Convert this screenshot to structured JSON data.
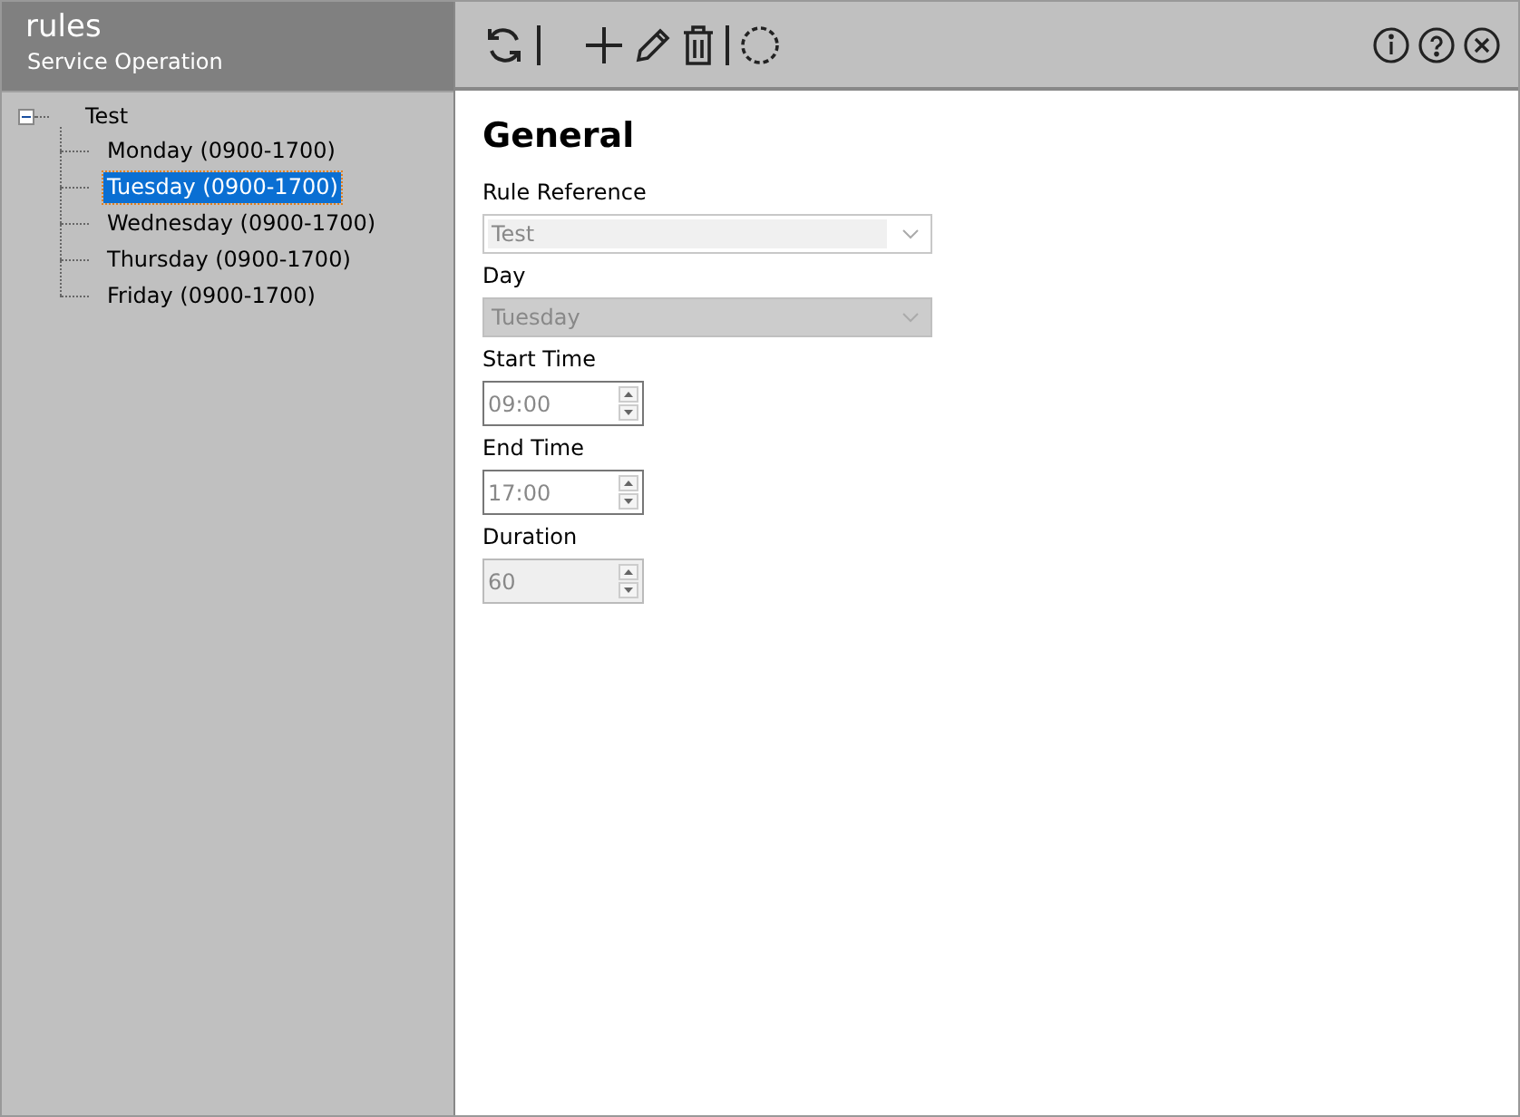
{
  "app": {
    "title": "rules",
    "subtitle": "Service Operation"
  },
  "tree": [
    {
      "label": "Test",
      "expanded": true,
      "children": [
        {
          "label": "Monday (0900-1700)",
          "selected": false
        },
        {
          "label": "Tuesday  (0900-1700)",
          "selected": true
        },
        {
          "label": "Wednesday (0900-1700)",
          "selected": false
        },
        {
          "label": "Thursday  (0900-1700)",
          "selected": false
        },
        {
          "label": "Friday  (0900-1700)",
          "selected": false
        }
      ]
    }
  ],
  "form": {
    "heading": "General",
    "fields": [
      {
        "kind": "dropdown",
        "label": "Rule Reference",
        "value": "Test",
        "disabled": false
      },
      {
        "kind": "dropdown",
        "label": "Day",
        "value": "Tuesday",
        "disabled": true
      },
      {
        "kind": "spinner",
        "label": "Start Time",
        "value": "09:00",
        "disabled": false
      },
      {
        "kind": "spinner",
        "label": "End Time",
        "value": "17:00",
        "disabled": false
      },
      {
        "kind": "spinner",
        "label": "Duration",
        "value": "60",
        "disabled": true
      }
    ]
  }
}
